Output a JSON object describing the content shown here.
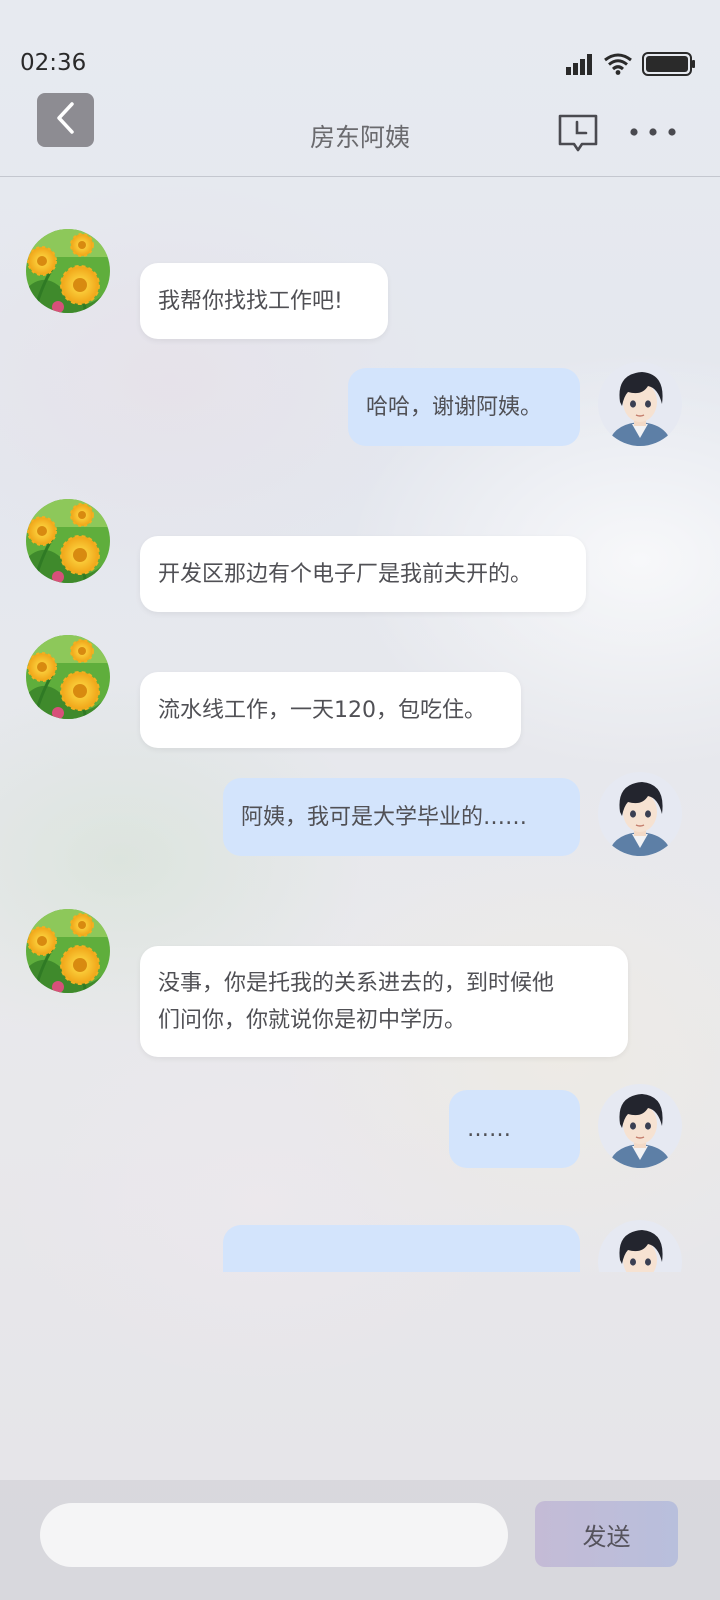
{
  "status_bar": {
    "time": "02:36",
    "icons": [
      "signal-icon",
      "wifi-icon",
      "battery-icon"
    ]
  },
  "header": {
    "back_icon": "chevron-left-icon",
    "title": "房东阿姨",
    "history_icon": "chat-history-icon",
    "more_icon": "more-icon"
  },
  "messages": [
    {
      "from": "landlady",
      "text": "我帮你找找工作吧!"
    },
    {
      "from": "me",
      "text": "哈哈，谢谢阿姨。"
    },
    {
      "from": "landlady",
      "text": "开发区那边有个电子厂是我前夫开的。"
    },
    {
      "from": "landlady",
      "text": "流水线工作，一天120，包吃住。"
    },
    {
      "from": "me",
      "text": "阿姨，我可是大学毕业的……"
    },
    {
      "from": "landlady",
      "text_line1": "没事，你是托我的关系进去的，到时候他",
      "text_line2": "们问你，你就说你是初中学历。"
    },
    {
      "from": "me",
      "text": "……"
    },
    {
      "from": "me",
      "text": ""
    }
  ],
  "composer": {
    "input_value": "",
    "send_label": "发送"
  },
  "colors": {
    "incoming_bubble": "#ffffff",
    "outgoing_bubble": "#d3e4fc",
    "back_button": "#8d8c92"
  }
}
